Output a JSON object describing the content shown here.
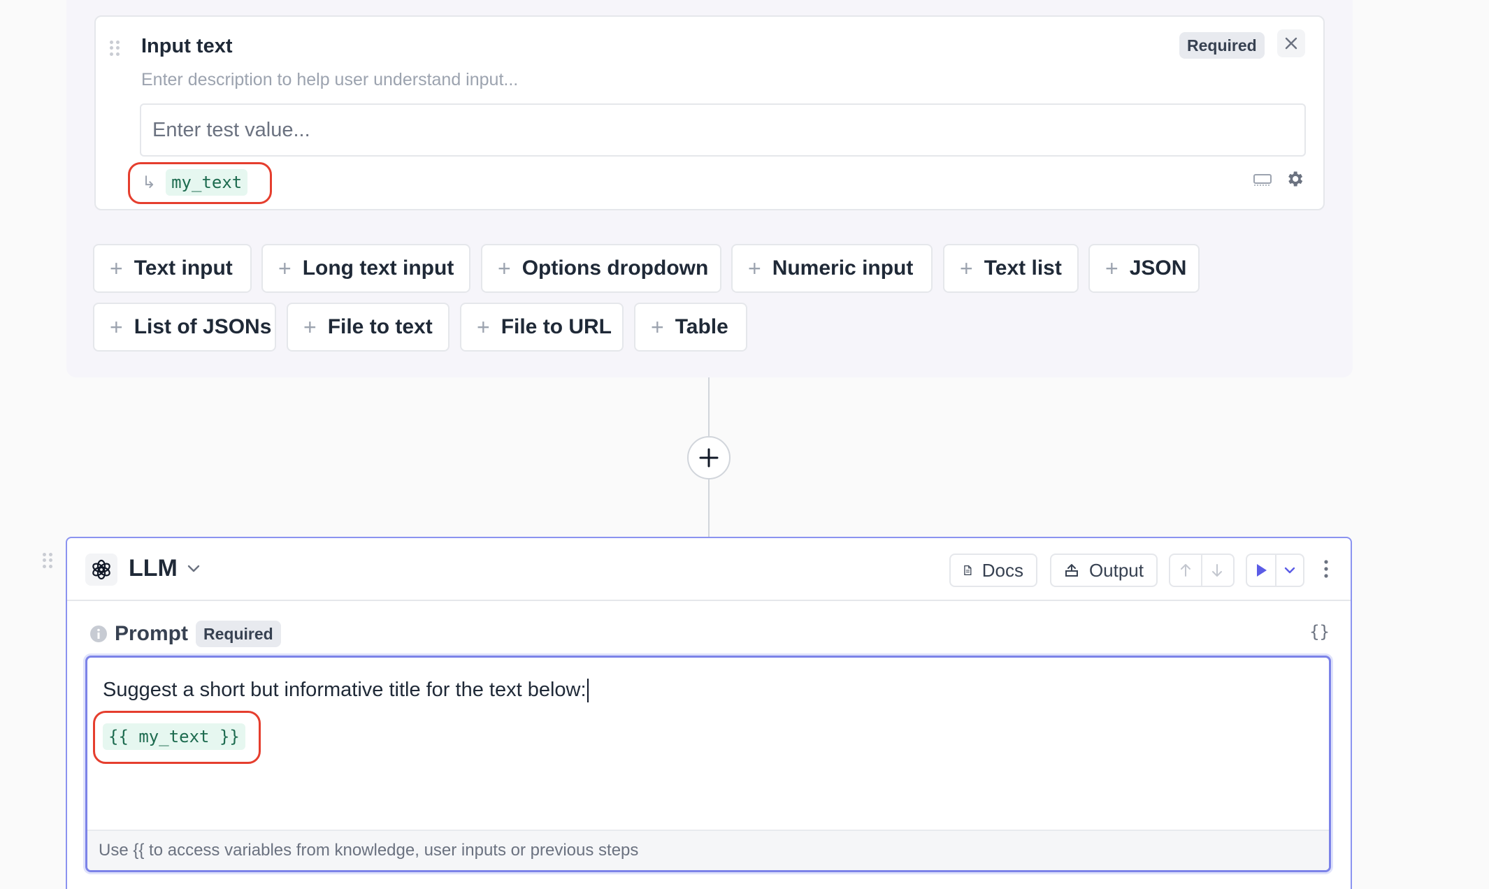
{
  "input_card": {
    "title": "Input text",
    "required_badge": "Required",
    "description_placeholder": "Enter description to help user understand input...",
    "test_value_placeholder": "Enter test value...",
    "variable_arrow": "↳",
    "variable_name": "my_text"
  },
  "add_inputs": [
    {
      "label": "Text input"
    },
    {
      "label": "Long text input"
    },
    {
      "label": "Options dropdown"
    },
    {
      "label": "Numeric input"
    },
    {
      "label": "Text list"
    },
    {
      "label": "JSON"
    },
    {
      "label": "List of JSONs"
    },
    {
      "label": "File to text"
    },
    {
      "label": "File to URL"
    },
    {
      "label": "Table"
    }
  ],
  "llm_block": {
    "title": "LLM",
    "docs_label": "Docs",
    "output_label": "Output",
    "prompt_label": "Prompt",
    "required_badge": "Required",
    "braces_icon_text": "{}",
    "prompt_text": "Suggest a short but informative title for the text below:",
    "prompt_variable": "{{ my_text }}",
    "footer_hint": "Use {{ to access variables from knowledge, user inputs or previous steps"
  },
  "colors": {
    "accent": "#7c83e8",
    "highlight_ring": "#e53e2e",
    "variable_chip_bg": "#e6f7f0",
    "variable_chip_text": "#1d6b4f"
  },
  "icons": [
    "drag-handle-icon",
    "close-icon",
    "arrow-return-icon",
    "input-size-icon",
    "gear-icon",
    "plus-icon",
    "openai-icon",
    "chevron-down-icon",
    "document-icon",
    "output-icon",
    "arrow-up-icon",
    "arrow-down-icon",
    "play-icon",
    "kebab-icon",
    "info-icon",
    "braces-icon"
  ]
}
